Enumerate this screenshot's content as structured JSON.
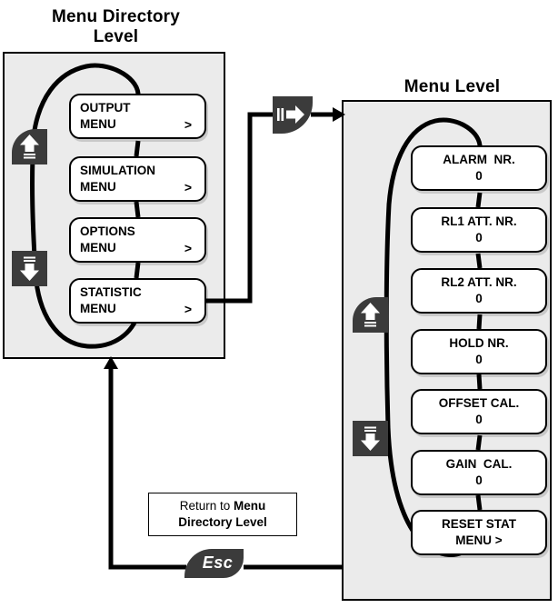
{
  "diagram": {
    "left_panel": {
      "title": "Menu Directory\nLevel",
      "title_line1": "Menu Directory",
      "title_line2": "Level",
      "items": [
        {
          "line1": "OUTPUT",
          "line2": "MENU",
          "chevron": ">"
        },
        {
          "line1": "SIMULATION",
          "line2": "MENU",
          "chevron": ">"
        },
        {
          "line1": "OPTIONS",
          "line2": "MENU",
          "chevron": ">"
        },
        {
          "line1": "STATISTIC",
          "line2": "MENU",
          "chevron": ">"
        }
      ],
      "scroll_up_icon": "up-arrow-key-icon",
      "scroll_down_icon": "down-arrow-key-icon"
    },
    "right_panel": {
      "title": "Menu Level",
      "items": [
        {
          "line1": "ALARM  NR.",
          "line2": "0"
        },
        {
          "line1": "RL1 ATT. NR.",
          "line2": "0"
        },
        {
          "line1": "RL2 ATT. NR.",
          "line2": "0"
        },
        {
          "line1": "HOLD NR.",
          "line2": "0"
        },
        {
          "line1": "OFFSET CAL.",
          "line2": "0"
        },
        {
          "line1": "GAIN  CAL.",
          "line2": "0"
        },
        {
          "line1": "RESET STAT",
          "line2": "MENU >"
        }
      ],
      "scroll_up_icon": "up-arrow-key-icon",
      "scroll_down_icon": "down-arrow-key-icon"
    },
    "enter_key": {
      "icon": "enter-right-arrow-key-icon",
      "label": ""
    },
    "return_note": {
      "text_prefix": "Return to ",
      "text_bold1": "Menu",
      "text_bold2": "Directory Level",
      "full_text": "Return to Menu Directory Level"
    },
    "esc_key": {
      "label": "Esc"
    },
    "colors": {
      "panel_fill": "#ebebeb",
      "panel_border": "#000000",
      "box_fill": "#ffffff",
      "box_border": "#000000",
      "key_icon_fill": "#3b3b3b",
      "key_icon_glyph": "#ffffff",
      "flow_line": "#000000",
      "text": "#000000"
    }
  }
}
